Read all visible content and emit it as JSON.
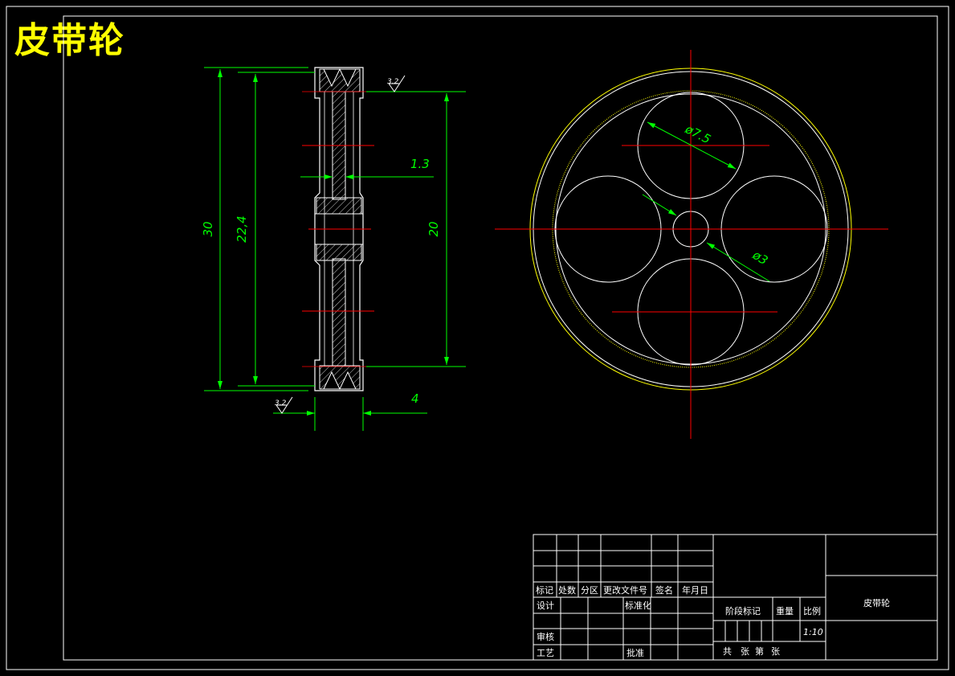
{
  "drawing": {
    "title": "皮带轮",
    "colors": {
      "background": "#000000",
      "outline": "#ffffff",
      "dimension": "#00ff00",
      "centerline": "#ff0000",
      "pitch_circle": "#ffff00"
    }
  },
  "dimensions": {
    "outer_diameter": "30",
    "groove_diameter": "22,4",
    "inner_diameter": "20",
    "web_thickness": "1.3",
    "width": "4",
    "hole_diameter": "ø7.5",
    "bore_diameter": "ø3",
    "roughness_top": "3.2",
    "roughness_bottom": "3.2"
  },
  "title_block": {
    "header_row": [
      "标记",
      "处数",
      "分区",
      "更改文件号",
      "签名",
      "年月日"
    ],
    "design": "设计",
    "standardization": "标准化",
    "review": "审核",
    "process": "工艺",
    "approve": "批准",
    "stage_mark": "阶段标记",
    "weight": "重量",
    "scale_label": "比例",
    "scale_value": "1:10",
    "part_name": "皮带轮",
    "sheet_total": "共",
    "sheet_unit1": "张",
    "sheet_no": "第",
    "sheet_unit2": "张"
  }
}
